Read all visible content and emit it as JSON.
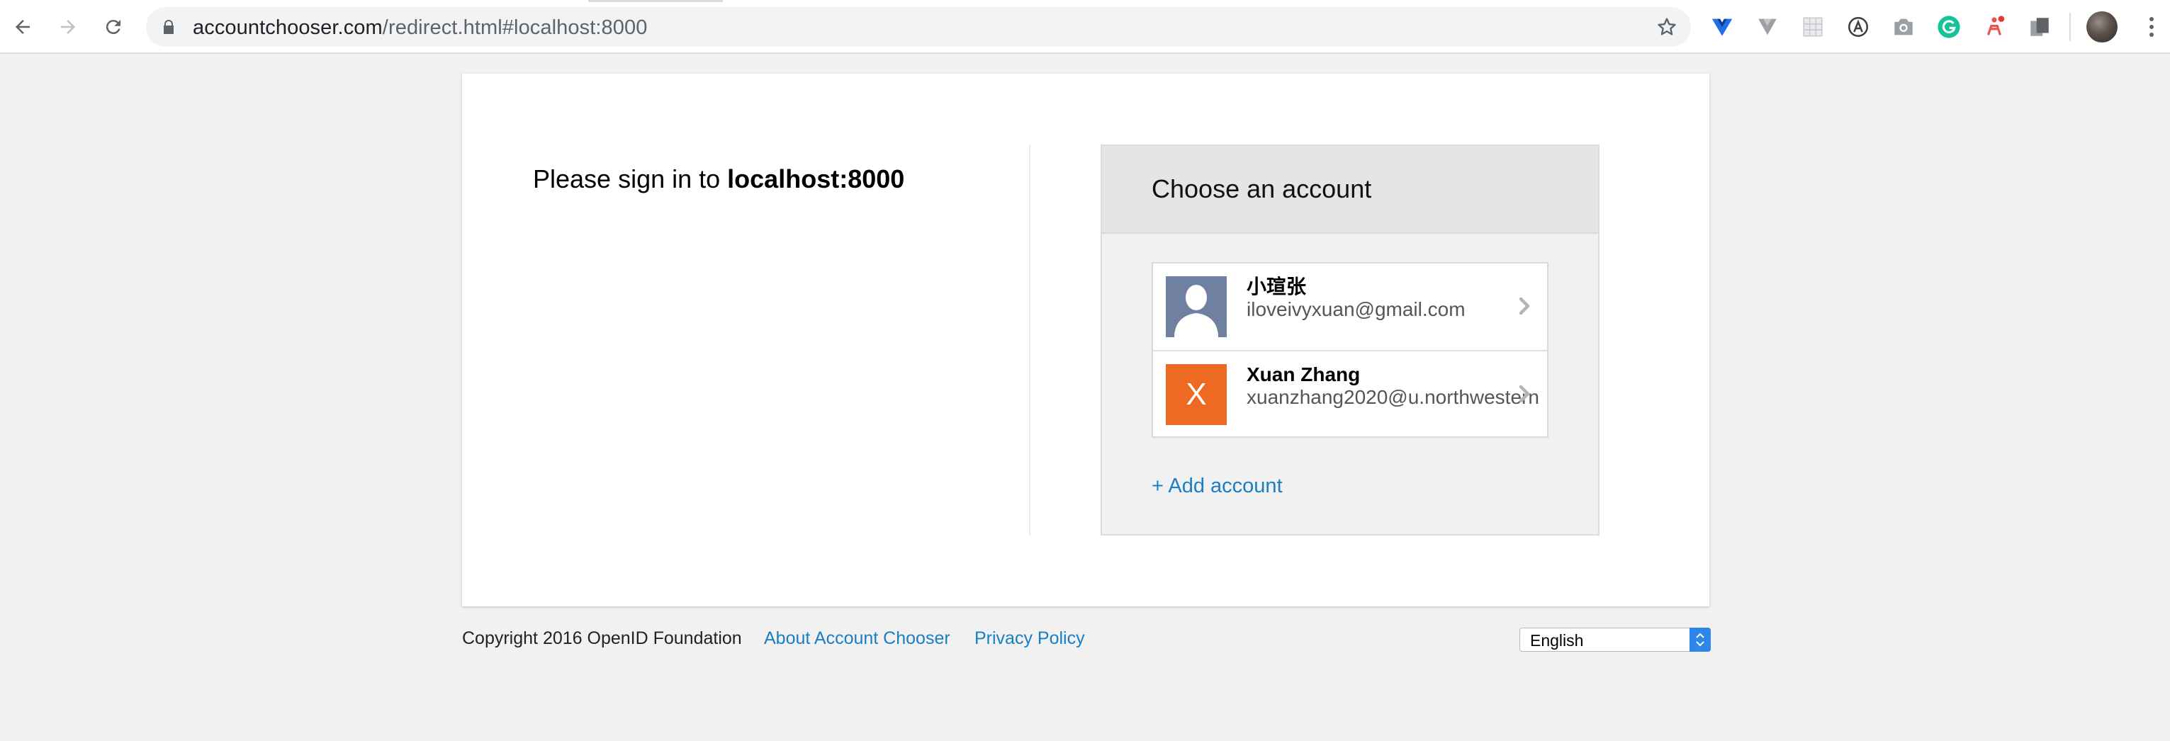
{
  "browser": {
    "url_host": "accountchooser.com",
    "url_path": "/redirect.html#localhost:8000",
    "icons": {
      "back": "back-arrow-icon",
      "forward": "forward-arrow-icon",
      "reload": "reload-icon",
      "lock": "lock-icon",
      "bookmark": "star-icon",
      "extensions": [
        "vue-devtools-icon",
        "v-extension-icon",
        "grid-extension-icon",
        "circled-a-icon",
        "camera-icon",
        "grammarly-icon",
        "figure-extension-icon",
        "documents-extension-icon"
      ],
      "profile": "profile-avatar-icon",
      "menu": "kebab-menu-icon"
    }
  },
  "page": {
    "signin_prefix": "Please sign in to ",
    "signin_site": "localhost:8000",
    "chooser_title": "Choose an account",
    "accounts": [
      {
        "name": "小瑄张",
        "email": "iloveivyxuan@gmail.com",
        "avatar_type": "silhouette-photo"
      },
      {
        "name": "Xuan Zhang",
        "email": "xuanzhang2020@u.northwestern",
        "avatar_letter": "X",
        "avatar_color": "#ee6a23"
      }
    ],
    "add_account": "+ Add account"
  },
  "footer": {
    "copyright": "Copyright 2016 OpenID Foundation",
    "about_link": "About Account Chooser",
    "privacy_link": "Privacy Policy",
    "language": "English"
  },
  "colors": {
    "link": "#1a7ec4",
    "page_bg": "#f1f1f1",
    "chooser_header_bg": "#e5e5e5",
    "select_arrow": "#2d86e8"
  }
}
